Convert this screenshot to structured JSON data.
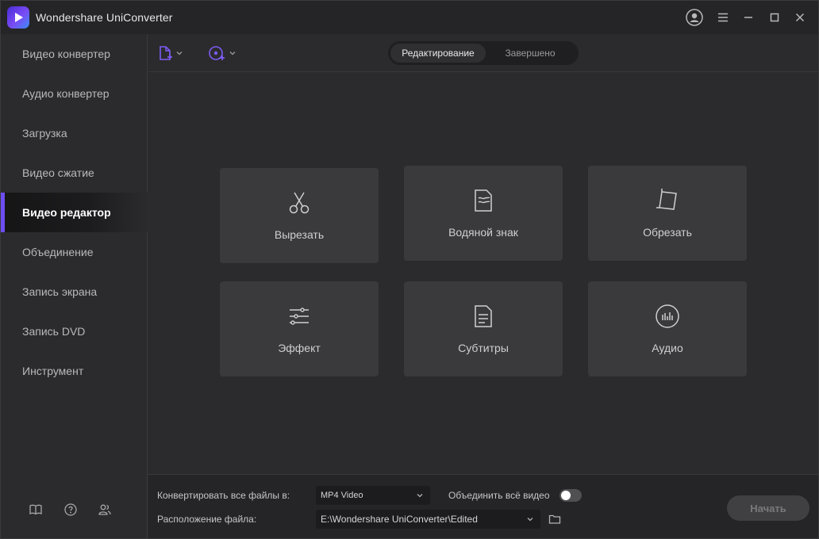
{
  "app": {
    "title": "Wondershare UniConverter"
  },
  "sidebar": {
    "items": [
      {
        "label": "Видео конвертер"
      },
      {
        "label": "Аудио конвертер"
      },
      {
        "label": "Загрузка"
      },
      {
        "label": "Видео сжатие"
      },
      {
        "label": "Видео редактор",
        "active": true
      },
      {
        "label": "Объединение"
      },
      {
        "label": "Запись экрана"
      },
      {
        "label": "Запись DVD"
      },
      {
        "label": "Инструмент"
      }
    ],
    "footer_icons": [
      "book-icon",
      "help-icon",
      "users-icon"
    ]
  },
  "toolbar": {
    "tabs": [
      {
        "label": "Редактирование",
        "active": true
      },
      {
        "label": "Завершено"
      }
    ]
  },
  "editor": {
    "cards": [
      {
        "label": "Вырезать",
        "icon": "scissors-icon"
      },
      {
        "label": "Водяной знак",
        "icon": "watermark-icon"
      },
      {
        "label": "Обрезать",
        "icon": "crop-icon"
      },
      {
        "label": "Эффект",
        "icon": "effect-sliders-icon"
      },
      {
        "label": "Субтитры",
        "icon": "subtitles-icon"
      },
      {
        "label": "Аудио",
        "icon": "audio-icon"
      }
    ]
  },
  "bottom": {
    "convert_label": "Конвертировать все файлы в:",
    "format_value": "MP4 Video",
    "merge_label": "Объединить всё видео",
    "merge_on": false,
    "location_label": "Расположение файла:",
    "location_value": "E:\\Wondershare UniConverter\\Edited",
    "start_label": "Начать"
  },
  "colors": {
    "accent": "#6d4df2",
    "background": "#2b2b2d",
    "card": "#3a3a3c"
  }
}
